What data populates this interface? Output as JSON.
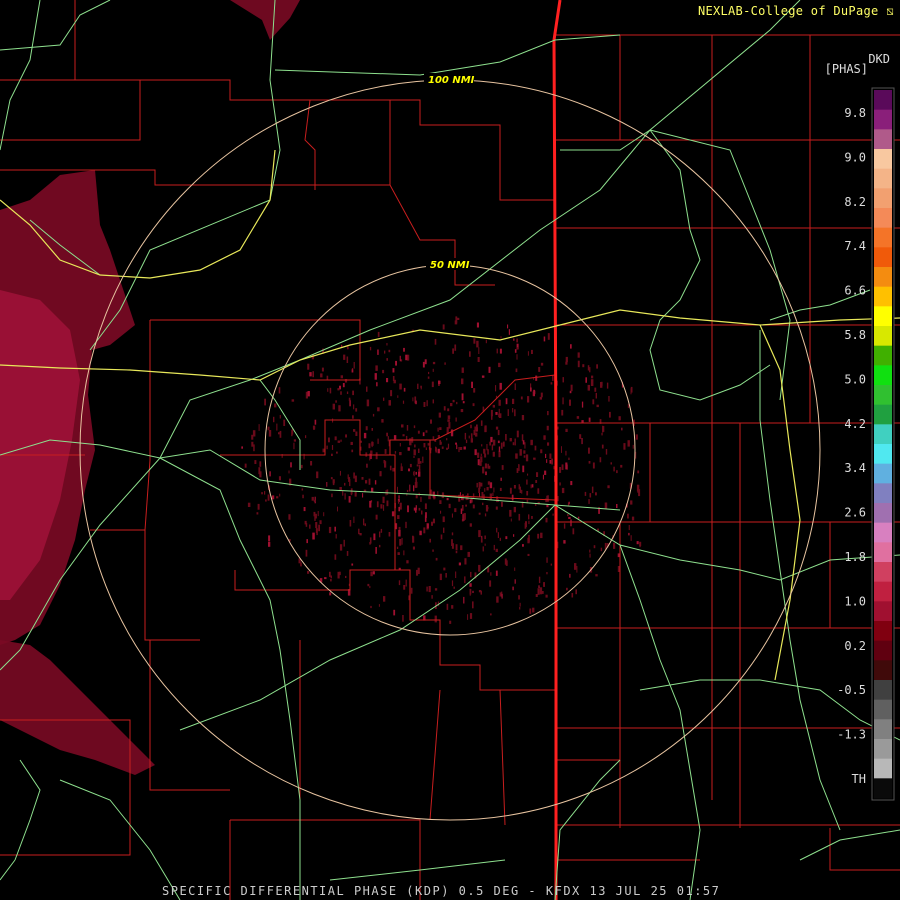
{
  "header": {
    "credit": "NEXLAB-College of DuPage",
    "credit_icon": "lasso-cursor-icon",
    "station_id": "DKD",
    "units": "[PHAS]"
  },
  "footer": {
    "caption": "SPECIFIC DIFFERENTIAL PHASE (KDP) 0.5 DEG - KFDX 13 JUL 25 01:57"
  },
  "range_rings": [
    {
      "label": "50 NMI"
    },
    {
      "label": "100 NMI"
    }
  ],
  "colors": {
    "state_line": "#ff2020",
    "county_line": "#c81e1e",
    "highway": "#8ee08e",
    "interstate": "#e8e85a",
    "range_ring": "#e8c4a0",
    "echo": "#7a0a24"
  },
  "legend": {
    "ticks": [
      "9.8",
      "9.0",
      "8.2",
      "7.4",
      "6.6",
      "5.8",
      "5.0",
      "4.2",
      "3.4",
      "2.6",
      "1.8",
      "1.0",
      "0.2",
      "-0.5",
      "-1.3",
      "TH"
    ],
    "bands": [
      "#5a0a5a",
      "#8a1f7a",
      "#b05a8a",
      "#f8c8a0",
      "#f4b488",
      "#f2a070",
      "#f48a58",
      "#f47428",
      "#f05a0a",
      "#f48c10",
      "#ffc000",
      "#ffff00",
      "#d8e800",
      "#40b000",
      "#10e010",
      "#30c030",
      "#20a040",
      "#40d0c0",
      "#50e8f0",
      "#60b0e0",
      "#8080c0",
      "#a070b0",
      "#d880c0",
      "#e070a0",
      "#d04060",
      "#c02040",
      "#a01030",
      "#800010",
      "#600010",
      "#400a0a",
      "#404040",
      "#606060",
      "#808080",
      "#9a9a9a",
      "#b8b8b8",
      "#0a0a0a"
    ]
  }
}
